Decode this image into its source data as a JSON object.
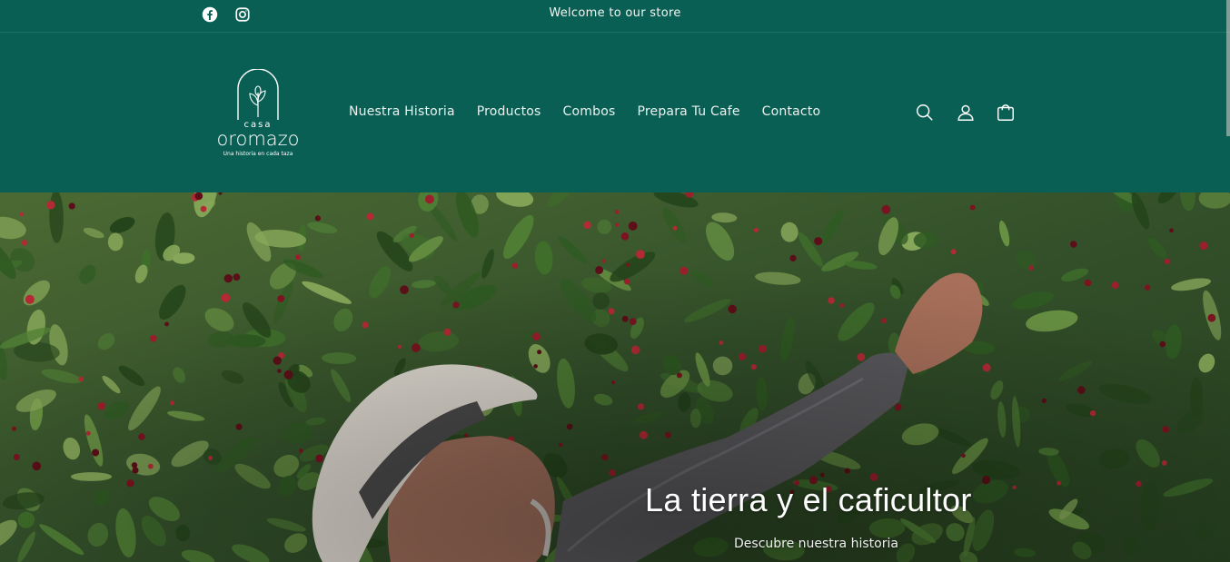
{
  "announcement": {
    "text": "Welcome to our store",
    "social": [
      "facebook-icon",
      "instagram-icon"
    ]
  },
  "header": {
    "logo": {
      "brand_top": "casa",
      "brand_main": "oromazo",
      "tagline": "Una historia en cada taza"
    },
    "nav": [
      {
        "label": "Nuestra Historia"
      },
      {
        "label": "Productos"
      },
      {
        "label": "Combos"
      },
      {
        "label": "Prepara Tu Cafe"
      },
      {
        "label": "Contacto"
      }
    ],
    "icons": [
      "search-icon",
      "account-icon",
      "cart-icon"
    ]
  },
  "hero": {
    "title": "La tierra y el caficultor",
    "subtitle": "Descubre nuestra historia"
  },
  "colors": {
    "brand_green": "#0a5f54",
    "text_light": "#eaf1ee"
  }
}
